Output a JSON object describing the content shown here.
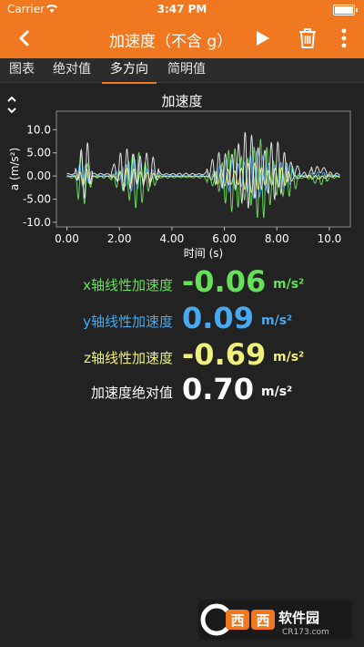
{
  "status_bar": {
    "carrier": "Carrier",
    "time": "3:47 PM"
  },
  "app_bar": {
    "title": "加速度（不含 g）",
    "accent": "#f07820"
  },
  "tabs": [
    {
      "label": "图表",
      "active": false
    },
    {
      "label": "绝对值",
      "active": false
    },
    {
      "label": "多方向",
      "active": true
    },
    {
      "label": "简明值",
      "active": false
    }
  ],
  "chart_data": {
    "type": "line",
    "title": "加速度",
    "xlabel": "时间 (s)",
    "ylabel": "a (m/s²)",
    "xlim": [
      -0.4,
      10.8
    ],
    "ylim": [
      -11,
      14
    ],
    "xticks": [
      "0.00",
      "2.00",
      "4.00",
      "6.00",
      "8.00",
      "10.0"
    ],
    "xtick_values": [
      0,
      2,
      4,
      6,
      8,
      10
    ],
    "yticks": [
      "10.0",
      "5.00",
      "0.00",
      "-5.00",
      "-10.0"
    ],
    "ytick_values": [
      10,
      5,
      0,
      -5,
      -10
    ],
    "series": [
      {
        "color": "#66e05a"
      },
      {
        "color": "#48a8f0"
      },
      {
        "color": "#f0f07a"
      },
      {
        "color": "#e8e8e8"
      }
    ]
  },
  "readouts": [
    {
      "label": "x轴线性加速度",
      "value": "-0.06",
      "unit": "m/s²",
      "color": "#66e05a"
    },
    {
      "label": "y轴线性加速度",
      "value": "0.09",
      "unit": "m/s²",
      "color": "#48a8f0"
    },
    {
      "label": "z轴线性加速度",
      "value": "-0.69",
      "unit": "m/s²",
      "color": "#f0f07a"
    },
    {
      "label": "加速度绝对值",
      "value": "0.70",
      "unit": "m/s²",
      "color": "#ffffff"
    }
  ],
  "watermark": {
    "text_main": "软件园",
    "text_sub": "CR173.com"
  }
}
